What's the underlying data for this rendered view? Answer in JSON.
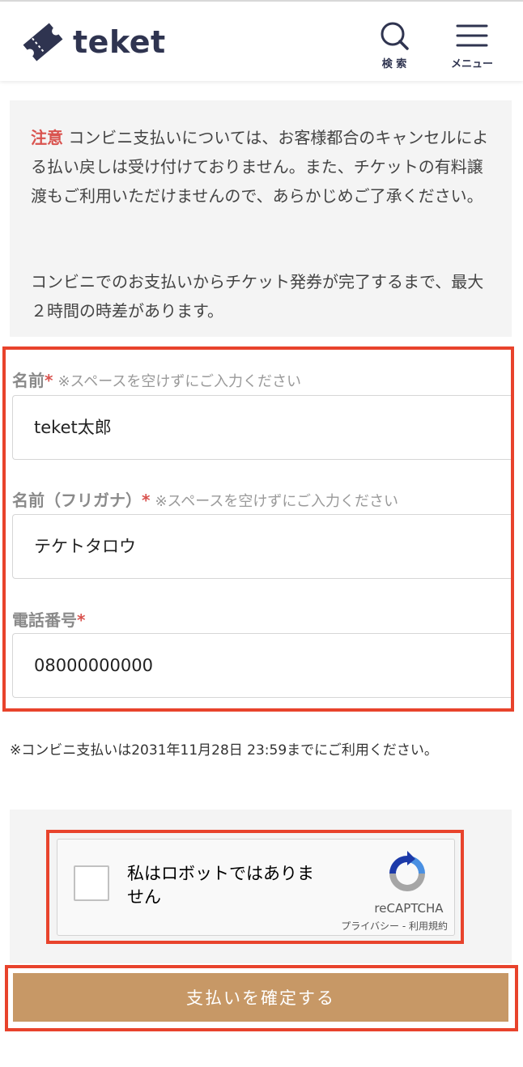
{
  "header": {
    "logo_text": "teket",
    "search_label": "検 索",
    "menu_label": "メニュー",
    "colors": {
      "brand": "#2f3450"
    }
  },
  "notice": {
    "warning_label": "注意",
    "paragraph1": "コンビニ支払いについては、お客様都合のキャンセルによる払い戻しは受け付けておりません。また、チケットの有料譲渡もご利用いただけませんので、あらかじめご了承ください。",
    "paragraph2": "コンビニでのお支払いからチケット発券が完了するまで、最大２時間の時差があります。"
  },
  "form": {
    "name": {
      "label": "名前",
      "required_mark": "*",
      "hint": "※スペースを空けずにご入力ください",
      "value": "teket太郎"
    },
    "name_kana": {
      "label": "名前（フリガナ）",
      "required_mark": "*",
      "hint": "※スペースを空けずにご入力ください",
      "value": "テケトタロウ"
    },
    "phone": {
      "label": "電話番号",
      "required_mark": "*",
      "value": "08000000000"
    }
  },
  "deadline_note": "※コンビニ支払いは2031年11月28日 23:59までにご利用ください。",
  "recaptcha": {
    "checkbox_label": "私はロボットではありません",
    "brand": "reCAPTCHA",
    "links": "プライバシー - 利用規約"
  },
  "submit": {
    "label": "支払いを確定する",
    "color": "#c79866"
  },
  "colors": {
    "highlight_border": "#e8432c",
    "warning_red": "#d9534f"
  }
}
